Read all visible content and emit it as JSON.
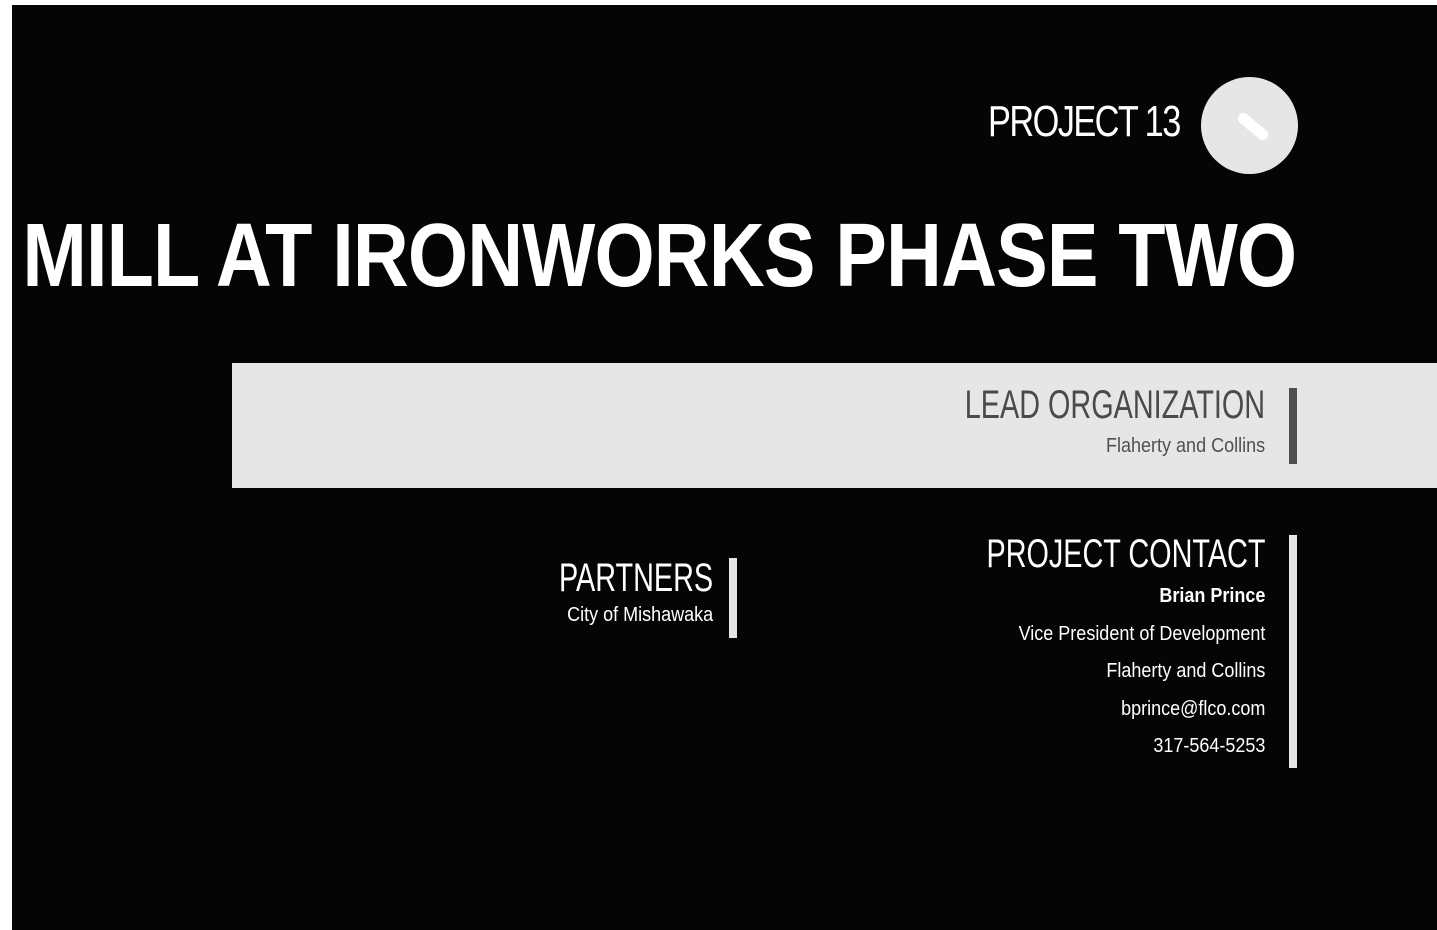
{
  "header": {
    "project_number": "PROJECT 13",
    "title": "THE MILL AT IRONWORKS PHASE TWO"
  },
  "lead_organization": {
    "heading": "LEAD ORGANIZATION",
    "name": "Flaherty and Collins"
  },
  "partners": {
    "heading": "PARTNERS",
    "name": "City of Mishawaka"
  },
  "project_contact": {
    "heading": "PROJECT CONTACT",
    "name": "Brian Prince",
    "role": "Vice President of Development",
    "organization": "Flaherty and Collins",
    "email": "bprince@flco.com",
    "phone": "317-564-5253"
  },
  "colors": {
    "background": "#050505",
    "band": "#e6e6e6",
    "text_light": "#ffffff",
    "text_dark": "#4a4a4a"
  },
  "icons": {
    "badge": "pencil-badge-icon"
  }
}
